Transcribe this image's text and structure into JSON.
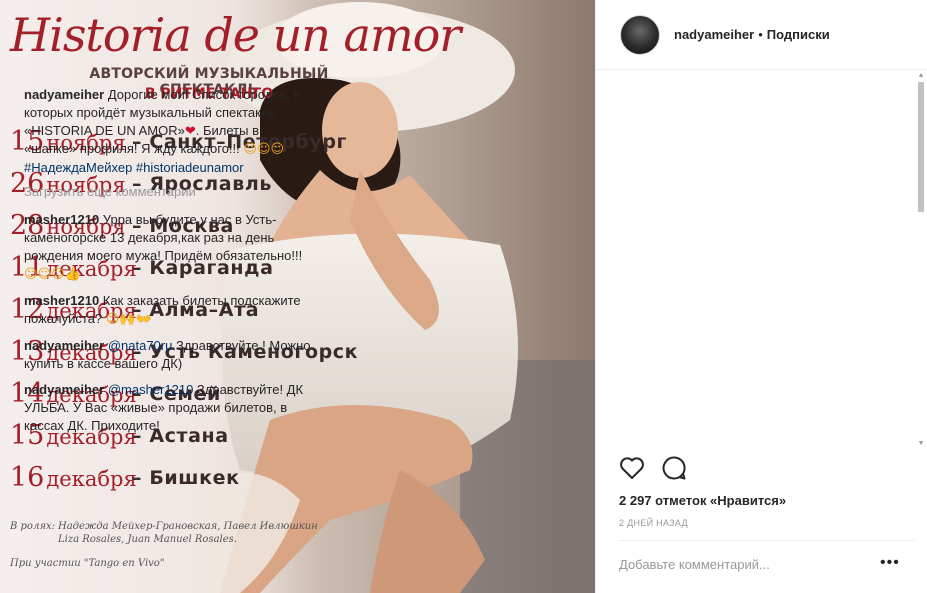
{
  "poster": {
    "title": "Historia de un amor",
    "subtitle1": "АВТОРСКИЙ МУЗЫКАЛЬНЫЙ СПЕКТАКЛЬ",
    "subtitle2": "В РИТМЕ ТАНГО",
    "dates": [
      {
        "day": "15",
        "month": "ноября",
        "city": "– Санкт–Петербург"
      },
      {
        "day": "26",
        "month": "ноября",
        "city": "– Ярославль"
      },
      {
        "day": "28",
        "month": "ноября",
        "city": "– Москва"
      },
      {
        "day": "11",
        "month": "декабря",
        "city": "– Караганда"
      },
      {
        "day": "12",
        "month": "декабря",
        "city": "– Алма–Ата"
      },
      {
        "day": "13",
        "month": "декабря",
        "city": "– Усть Каменогорск"
      },
      {
        "day": "14",
        "month": "декабря",
        "city": "– Семей"
      },
      {
        "day": "15",
        "month": "декабря",
        "city": "– Астана"
      },
      {
        "day": "16",
        "month": "декабря",
        "city": "– Бишкек"
      }
    ],
    "credits_label": "В ролях:",
    "credits_line1": "Надежда Мейхер-Грановская, Павел Ивлюшкин",
    "credits_line2": "Liza Rosales, Juan Manuel Rosales.",
    "credits2": "При участии \"Tango en Vivo\""
  },
  "header": {
    "username": "nadyameiher",
    "dot": "•",
    "follow": "Подписки"
  },
  "caption": {
    "user": "nadyameiher",
    "text": "Дорогие мои! Список городов, в которых пройдёт музыкальный спектакль «HISTORIA DE UN AMOR»",
    "text2": ". Билеты в «шапке» профиля! Я жду каждого!!!",
    "heart": "❤",
    "emojis": "☺☺☺",
    "tags": "#НадеждаМейхер #historiadeunamor"
  },
  "load_more": "Загрузить еще комментарии",
  "comments": [
    {
      "user": "masher1210",
      "text": "Урра вы будите у нас в Усть-каменогорске 13 декабря,как раз на день рождения моего мужа! Придём обязательно!!!",
      "emojis": "☺☺☺👍"
    },
    {
      "user": "masher1210",
      "text": "Как заказать билеты,подскажите пожалуйста?",
      "emojis": "☺🙌👐"
    },
    {
      "user": "nadyameiher",
      "mention": "@nata70ru",
      "text": " Здравствуйте ! Можно купить в кассе вашего ДК)"
    },
    {
      "user": "nadyameiher",
      "mention": "@masher1210",
      "text": " Здравствуйте! ДК УЛЬБА. У Вас «живые» продажи билетов, в кассах ДК. Приходите!"
    }
  ],
  "likes": "2 297 отметок «Нравится»",
  "time_ago": "2 ДНЕЙ НАЗАД",
  "add_comment_placeholder": "Добавьте комментарий...",
  "more": "•••",
  "icons": [
    "heart-icon",
    "comment-icon",
    "scroll-up-icon",
    "scroll-down-icon"
  ],
  "colors": {
    "poster_red": "#a31f2a",
    "link_blue": "#003569",
    "heart_red": "#d0112b"
  }
}
